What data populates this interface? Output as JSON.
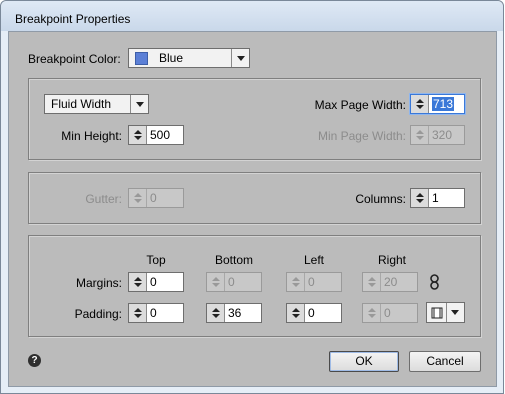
{
  "window": {
    "title": "Breakpoint Properties"
  },
  "breakpoint_color": {
    "label": "Breakpoint Color:",
    "value": "Blue",
    "swatch_color": "#5b7fd6"
  },
  "layout": {
    "mode": "Fluid Width",
    "max_page_width_label": "Max Page Width:",
    "max_page_width": "713",
    "min_height_label": "Min Height:",
    "min_height": "500",
    "min_page_width_label": "Min Page Width:",
    "min_page_width": "320"
  },
  "grid": {
    "gutter_label": "Gutter:",
    "gutter": "0",
    "columns_label": "Columns:",
    "columns": "1"
  },
  "spacing": {
    "headers": [
      "Top",
      "Bottom",
      "Left",
      "Right"
    ],
    "margins_label": "Margins:",
    "margins": [
      "0",
      "0",
      "0",
      "20"
    ],
    "padding_label": "Padding:",
    "padding": [
      "0",
      "36",
      "0",
      "0"
    ]
  },
  "buttons": {
    "ok": "OK",
    "cancel": "Cancel"
  },
  "icons": {
    "help": "?",
    "link": "chain-link-icon",
    "frame": "frame-icon"
  }
}
